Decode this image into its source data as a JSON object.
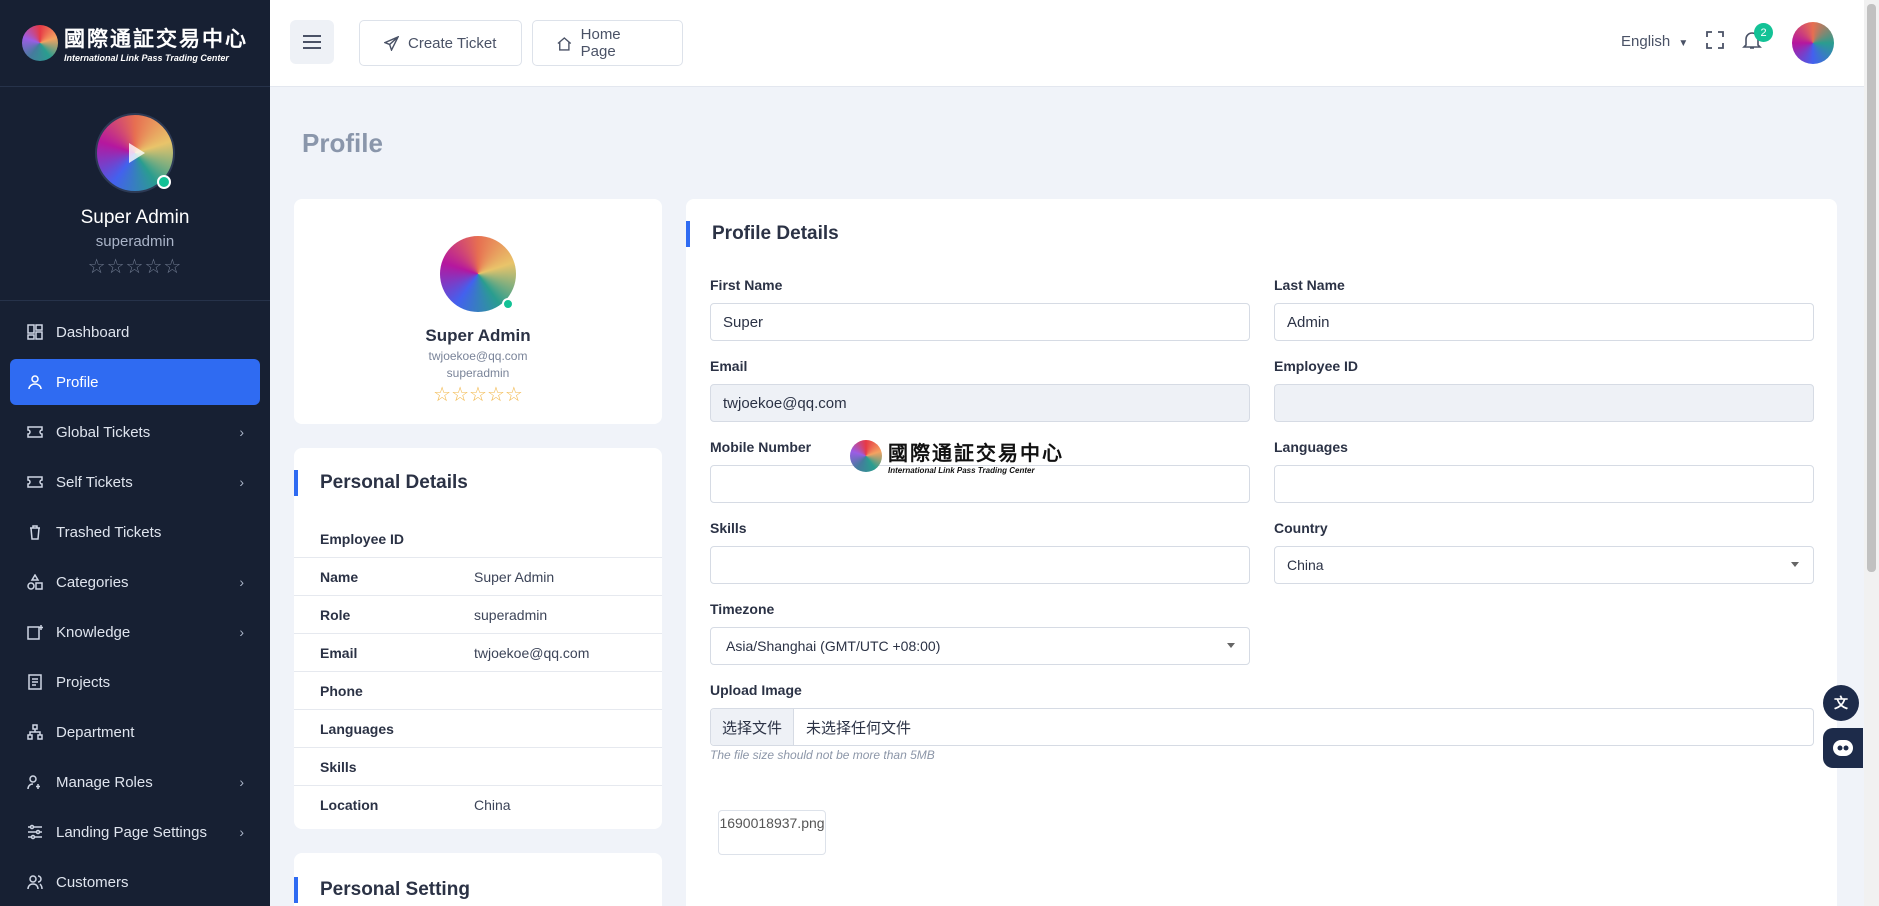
{
  "brand": {
    "title_cn": "國際通証交易中心",
    "title_en": "International Link Pass Trading Center"
  },
  "sidebar": {
    "user_name": "Super Admin",
    "username": "superadmin",
    "stars": "☆☆☆☆☆",
    "items": [
      {
        "label": "Dashboard",
        "icon": "dashboard-icon",
        "chevron": ""
      },
      {
        "label": "Profile",
        "icon": "user-icon",
        "chevron": ""
      },
      {
        "label": "Global Tickets",
        "icon": "ticket-icon",
        "chevron": "›"
      },
      {
        "label": "Self Tickets",
        "icon": "ticket-icon",
        "chevron": "›"
      },
      {
        "label": "Trashed Tickets",
        "icon": "trash-icon",
        "chevron": ""
      },
      {
        "label": "Categories",
        "icon": "category-icon",
        "chevron": "›"
      },
      {
        "label": "Knowledge",
        "icon": "knowledge-icon",
        "chevron": "›"
      },
      {
        "label": "Projects",
        "icon": "projects-icon",
        "chevron": ""
      },
      {
        "label": "Department",
        "icon": "department-icon",
        "chevron": ""
      },
      {
        "label": "Manage Roles",
        "icon": "roles-icon",
        "chevron": "›"
      },
      {
        "label": "Landing Page Settings",
        "icon": "settings-sliders-icon",
        "chevron": "›"
      },
      {
        "label": "Customers",
        "icon": "customers-icon",
        "chevron": ""
      }
    ]
  },
  "header": {
    "create_ticket": "Create Ticket",
    "home_page": "Home Page",
    "language": "English",
    "notification_count": "2"
  },
  "page": {
    "title": "Profile"
  },
  "profile_card": {
    "name": "Super Admin",
    "email": "twjoekoe@qq.com",
    "username": "superadmin",
    "stars": "☆☆☆☆☆"
  },
  "personal_details": {
    "title": "Personal Details",
    "rows": [
      {
        "key": "Employee ID",
        "value": ""
      },
      {
        "key": "Name",
        "value": "Super Admin"
      },
      {
        "key": "Role",
        "value": "superadmin"
      },
      {
        "key": "Email",
        "value": "twjoekoe@qq.com"
      },
      {
        "key": "Phone",
        "value": ""
      },
      {
        "key": "Languages",
        "value": ""
      },
      {
        "key": "Skills",
        "value": ""
      },
      {
        "key": "Location",
        "value": "China"
      }
    ]
  },
  "personal_setting": {
    "title": "Personal Setting"
  },
  "profile_details": {
    "title": "Profile Details",
    "first_name_label": "First Name",
    "first_name": "Super",
    "last_name_label": "Last Name",
    "last_name": "Admin",
    "email_label": "Email",
    "email": "twjoekoe@qq.com",
    "employee_id_label": "Employee ID",
    "employee_id": "",
    "mobile_label": "Mobile Number",
    "mobile": "",
    "languages_label": "Languages",
    "languages": "",
    "skills_label": "Skills",
    "skills": "",
    "country_label": "Country",
    "country": "China",
    "timezone_label": "Timezone",
    "timezone": "Asia/Shanghai (GMT/UTC +08:00)",
    "upload_label": "Upload Image",
    "choose_file": "选择文件",
    "no_file": "未选择任何文件",
    "upload_hint": "The file size should not be more than 5MB",
    "image_alt": "1690018937.png"
  },
  "colors": {
    "sidebar_bg": "#172033",
    "accent": "#2f6bf2",
    "badge": "#13c296"
  }
}
